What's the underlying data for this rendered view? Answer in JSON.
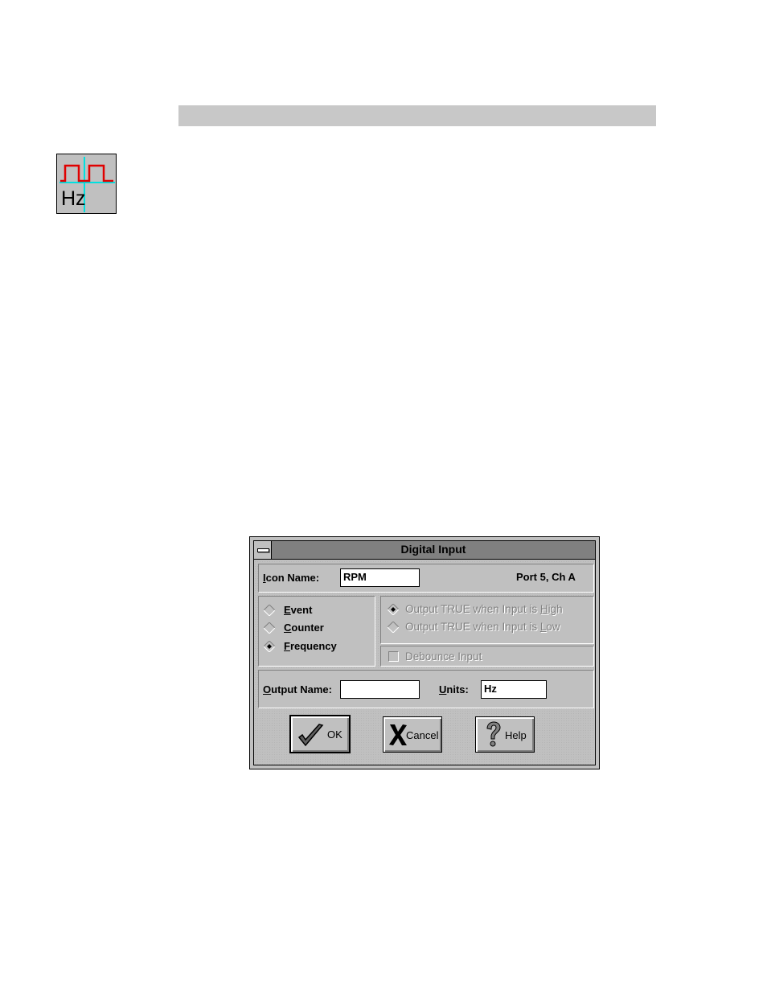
{
  "dialog": {
    "title": "Digital Input",
    "icon_name": {
      "label_u": "I",
      "label_rest": "con Name:",
      "value": "RPM"
    },
    "port_info": "Port 5, Ch A",
    "modes": [
      {
        "u": "E",
        "rest": "vent",
        "selected": false
      },
      {
        "u": "C",
        "rest": "ounter",
        "selected": false
      },
      {
        "u": "F",
        "rest": "requency",
        "selected": true
      }
    ],
    "output_options": [
      {
        "pre": "Output TRUE when Input is ",
        "u": "H",
        "rest": "igh",
        "selected": true
      },
      {
        "pre": "Output TRUE when Input is ",
        "u": "L",
        "rest": "ow",
        "selected": false
      }
    ],
    "debounce_label": "Debounce Input",
    "output_name": {
      "label_u": "O",
      "label_rest": "utput Name:",
      "value": ""
    },
    "units": {
      "label_u": "U",
      "label_rest": "nits:",
      "value": "Hz"
    },
    "buttons": {
      "ok": "OK",
      "cancel": "Cancel",
      "help": "Help"
    }
  },
  "tool_icon": {
    "name": "frequency-hz-icon",
    "text": "Hz"
  },
  "colors": {
    "waveform": "#e00000",
    "crosshair": "#00e0e0",
    "titlebar": "#808080"
  }
}
